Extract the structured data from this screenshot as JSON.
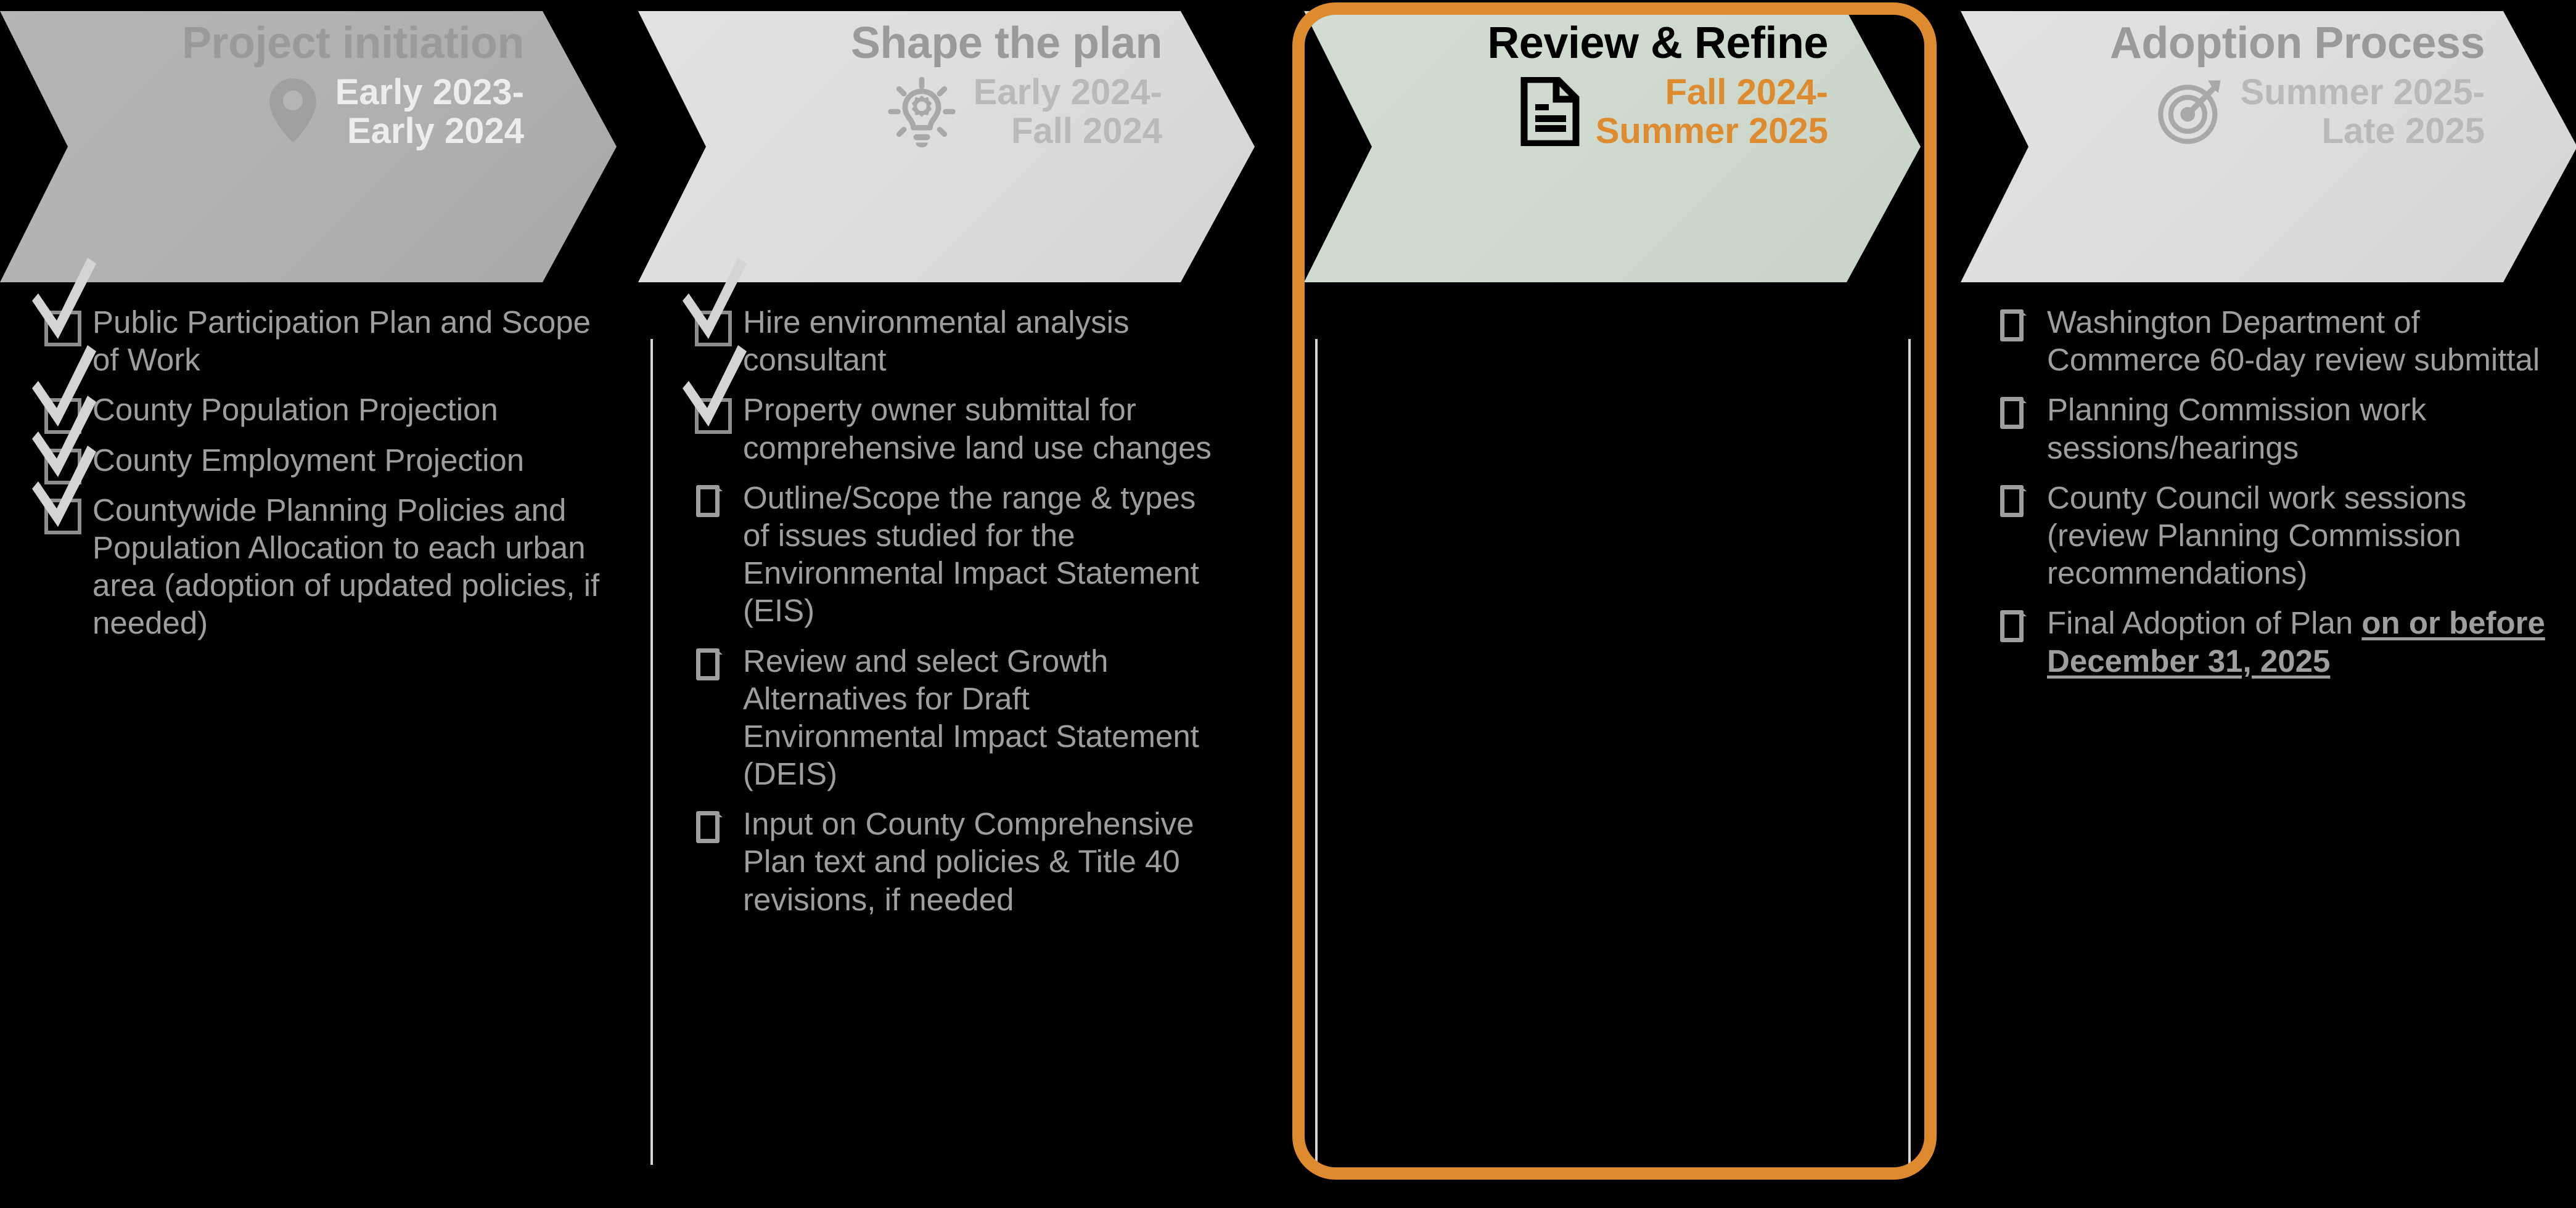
{
  "accent_colors": {
    "highlight_orange": "#dd8b2e",
    "active_banner_bg": "#cdd9cd",
    "inactive_banner_bg": "#dcdcdc",
    "first_banner_bg": "#b0b0b0",
    "muted_text": "#9e9e9e"
  },
  "phases": [
    {
      "id": "project-initiation",
      "title": "Project initiation",
      "dates_line1": "Early 2023-",
      "dates_line2": "Early 2024",
      "icon": "location-pin-icon",
      "active": false,
      "items": [
        {
          "text": "Public Participation Plan and Scope of Work",
          "checked": true
        },
        {
          "text": "County Population Projection",
          "checked": true
        },
        {
          "text": "County Employment Projection",
          "checked": true
        },
        {
          "text": "Countywide Planning Policies and Population Allocation to each urban area (adoption of updated policies, if needed)",
          "checked": true
        }
      ]
    },
    {
      "id": "shape-the-plan",
      "title": "Shape the plan",
      "dates_line1": "Early 2024-",
      "dates_line2": "Fall 2024",
      "icon": "lightbulb-gear-icon",
      "active": false,
      "items": [
        {
          "text": "Hire environmental analysis consultant",
          "checked": true
        },
        {
          "text": "Property owner submittal for comprehensive land use changes",
          "checked": true
        },
        {
          "text": "Outline/Scope the range & types of issues studied for the Environmental Impact Statement (EIS)",
          "checked": false
        },
        {
          "text": "Review and select Growth Alternatives for Draft Environmental Impact Statement (DEIS)",
          "checked": false
        },
        {
          "text": "Input on County Comprehensive Plan text and policies & Title 40 revisions, if needed",
          "checked": false
        }
      ]
    },
    {
      "id": "review-and-refine",
      "title": "Review & Refine",
      "dates_line1": "Fall 2024-",
      "dates_line2": "Summer 2025",
      "icon": "document-icon",
      "active": true,
      "items": []
    },
    {
      "id": "adoption-process",
      "title": "Adoption Process",
      "dates_line1": "Summer 2025-",
      "dates_line2": "Late 2025",
      "icon": "target-arrow-icon",
      "active": false,
      "items": [
        {
          "text": "Washington Department of Commerce 60-day review submittal",
          "checked": false
        },
        {
          "text": " Planning Commission work sessions/hearings",
          "checked": false
        },
        {
          "text": " County Council work sessions (review Planning Commission recommendations)",
          "checked": false
        },
        {
          "text": "Final Adoption of Plan ",
          "emphasis": "on or before December 31, 2025",
          "checked": false
        }
      ]
    }
  ]
}
